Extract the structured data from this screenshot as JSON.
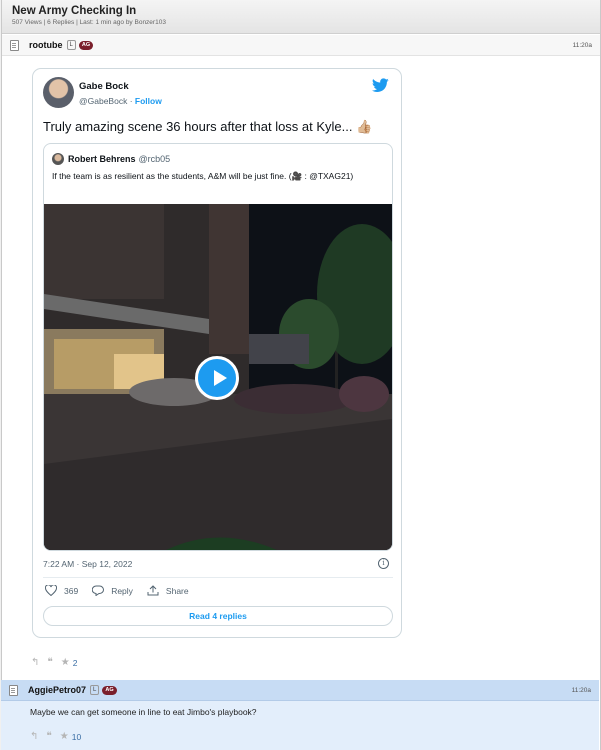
{
  "thread": {
    "title": "New Army Checking In",
    "stats": "507 Views | 6 Replies | Last: 1 min ago by Bonzer103"
  },
  "post1": {
    "username": "rootube",
    "badge_l": "L",
    "badge_ag": "AG",
    "time": "11:20a",
    "stars": "2"
  },
  "tweet": {
    "author_name": "Gabe Bock",
    "author_handle": "@GabeBock",
    "follow_label": "Follow",
    "text": "Truly amazing scene 36 hours after that loss at Kyle... 👍🏼",
    "quote": {
      "name": "Robert Behrens",
      "handle": "@rcb05",
      "text": "If the team is as resilient as the students, A&M will be just fine. (🎥 : @TXAG21)"
    },
    "date": "7:22 AM · Sep 12, 2022",
    "likes": "369",
    "reply_label": "Reply",
    "share_label": "Share",
    "read_replies": "Read 4 replies",
    "accent_color": "#1d9bf0"
  },
  "post2": {
    "username": "AggiePetro07",
    "badge_l": "L",
    "badge_ag": "AG",
    "time": "11:20a",
    "text": "Maybe we can get someone in line to eat Jimbo's playbook?",
    "stars": "10"
  },
  "icons": [
    "doc-icon",
    "twitter-bird-icon",
    "play-icon",
    "info-icon",
    "heart-icon",
    "reply-bubble-icon",
    "share-icon",
    "reply-arrow-icon",
    "quote-icon",
    "star-icon"
  ]
}
